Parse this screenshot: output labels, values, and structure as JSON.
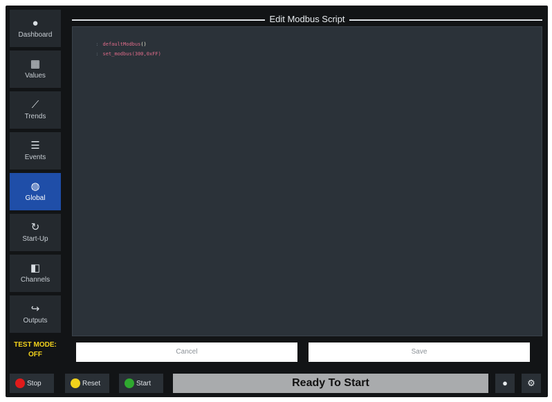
{
  "sidebar": {
    "items": [
      {
        "label": "Dashboard",
        "icon": "dashboard-gauge-icon",
        "glyph": "●"
      },
      {
        "label": "Values",
        "icon": "table-grid-icon",
        "glyph": "▦"
      },
      {
        "label": "Trends",
        "icon": "trend-chart-icon",
        "glyph": "⟋"
      },
      {
        "label": "Events",
        "icon": "list-icon",
        "glyph": "☰"
      },
      {
        "label": "Global",
        "icon": "globe-icon",
        "glyph": "◍"
      },
      {
        "label": "Start-Up",
        "icon": "refresh-icon",
        "glyph": "↻"
      },
      {
        "label": "Channels",
        "icon": "channels-icon",
        "glyph": "◧"
      },
      {
        "label": "Outputs",
        "icon": "output-arrow-icon",
        "glyph": "↪"
      }
    ],
    "active_index": 4,
    "test_mode_line1": "TEST MODE:",
    "test_mode_line2": "OFF"
  },
  "editor": {
    "title": "Edit Modbus Script",
    "lines": [
      {
        "gutter": ":",
        "code": "defaultModbus",
        "paren": "()"
      },
      {
        "gutter": ":",
        "code": "set_modbus(",
        "paren": "300,0xFF)"
      }
    ],
    "cancel_label": "Cancel",
    "save_label": "Save"
  },
  "bottom_bar": {
    "stop_label": "Stop",
    "reset_label": "Reset",
    "start_label": "Start",
    "status_text": "Ready To Start",
    "info_icon": "info-icon",
    "settings_icon": "gear-icon"
  },
  "colors": {
    "background": "#121416",
    "accent_active": "#1f4ea8",
    "test_mode": "#f2d21c",
    "stop": "#e01b1b",
    "reset": "#f2d21c",
    "start": "#2fa82f",
    "status_bar": "#a9abad"
  }
}
